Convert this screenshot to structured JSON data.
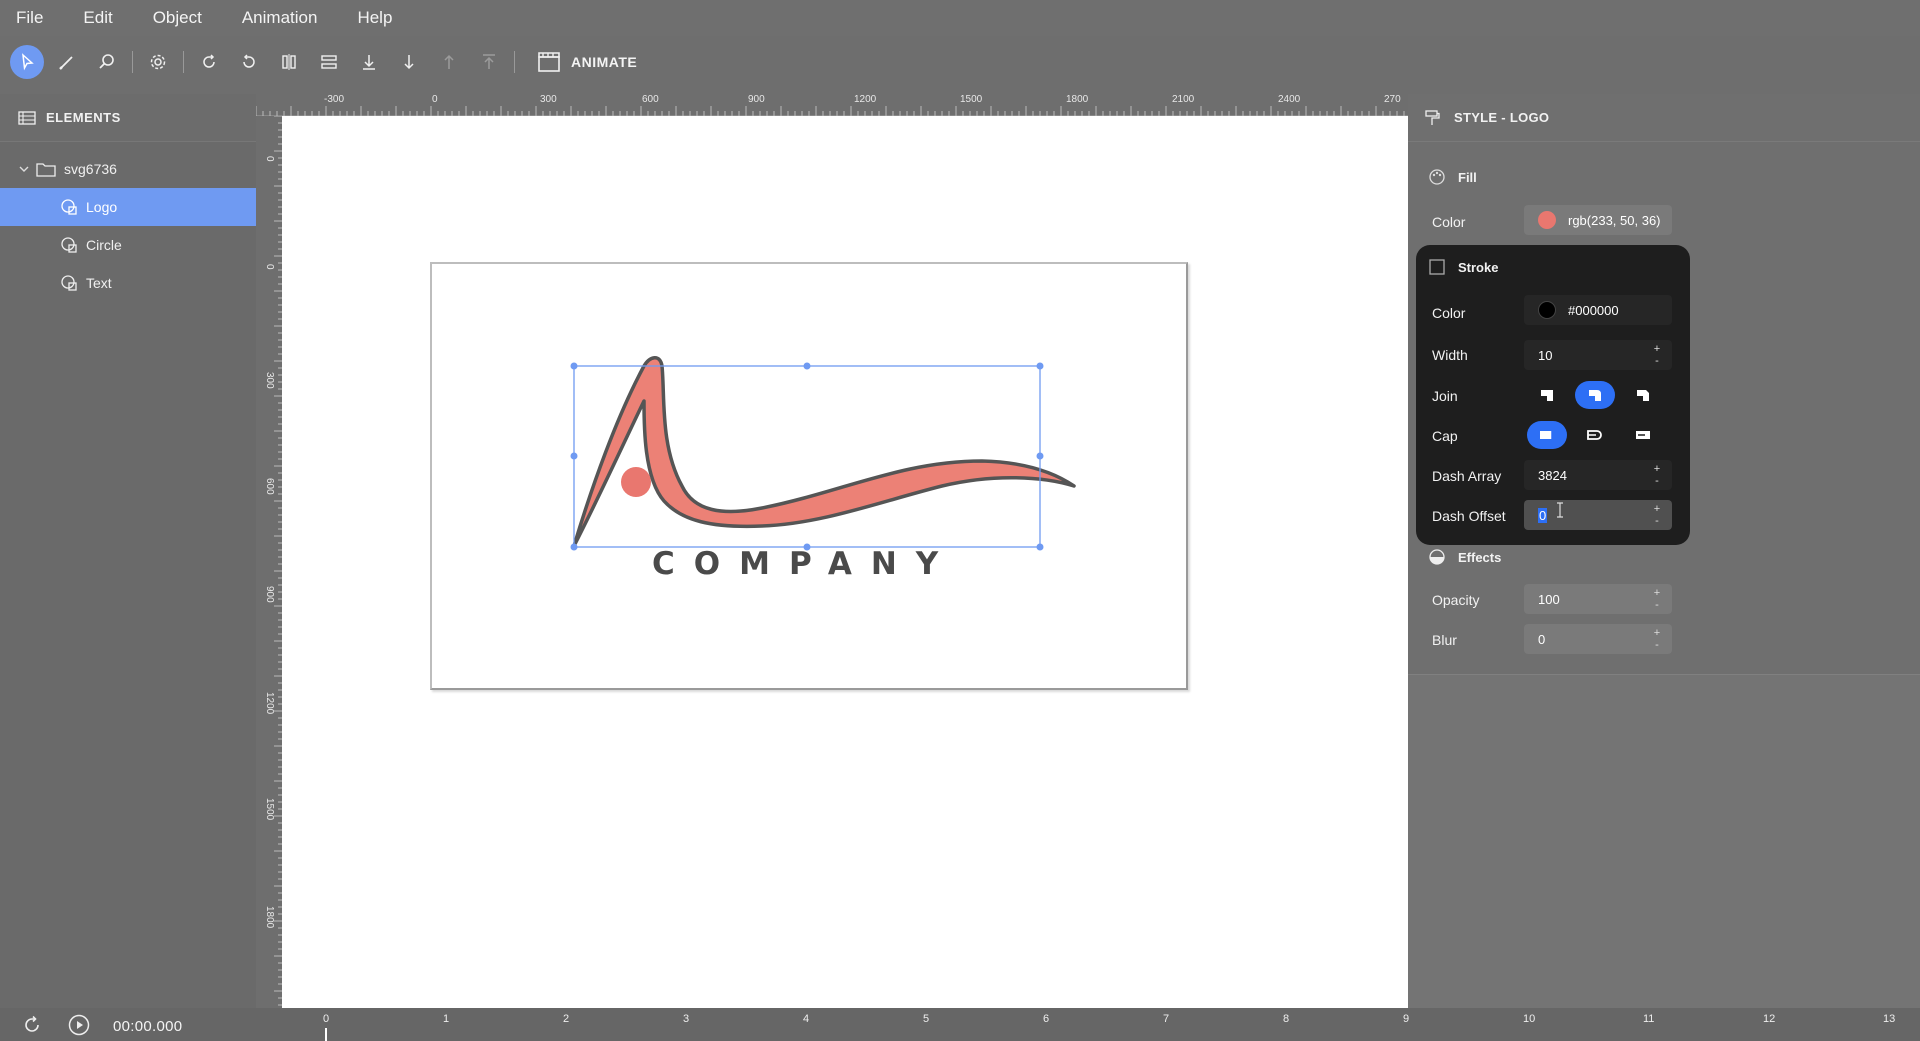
{
  "menu": {
    "items": [
      "File",
      "Edit",
      "Object",
      "Animation",
      "Help"
    ]
  },
  "toolbar": {
    "animate_label": "ANIMATE"
  },
  "elements_panel": {
    "title": "ELEMENTS",
    "group_name": "svg6736",
    "children": [
      "Logo",
      "Circle",
      "Text"
    ],
    "selected": "Logo"
  },
  "ruler_top": [
    "-300",
    "0",
    "300",
    "600",
    "900",
    "1200",
    "1500",
    "1800",
    "2100",
    "2400",
    "270"
  ],
  "ruler_left": [
    "0",
    "0",
    "300",
    "600",
    "900",
    "1200",
    "1500",
    "1800"
  ],
  "canvas": {
    "logo_text": "COMPANY",
    "fill_color": "#ec8176",
    "stroke_color": "#555555"
  },
  "style_panel": {
    "title": "STYLE - LOGO",
    "fill": {
      "title": "Fill",
      "color_label": "Color",
      "color_value": "rgb(233, 50, 36)",
      "swatch": "#e9776f"
    },
    "stroke": {
      "title": "Stroke",
      "color_label": "Color",
      "color_value": "#000000",
      "width_label": "Width",
      "width_value": "10",
      "join_label": "Join",
      "cap_label": "Cap",
      "dash_array_label": "Dash Array",
      "dash_array_value": "3824",
      "dash_offset_label": "Dash Offset",
      "dash_offset_value": "0"
    },
    "effects": {
      "title": "Effects",
      "opacity_label": "Opacity",
      "opacity_value": "100",
      "blur_label": "Blur",
      "blur_value": "0"
    }
  },
  "timeline": {
    "time": "00:00.000",
    "ticks": [
      "0",
      "1",
      "2",
      "3",
      "4",
      "5",
      "6",
      "7",
      "8",
      "9",
      "10",
      "11",
      "12",
      "13"
    ]
  },
  "colors": {
    "accent": "#6f9af2",
    "active_blue": "#2d6ff5",
    "selection_handle": "#6f9af2"
  }
}
